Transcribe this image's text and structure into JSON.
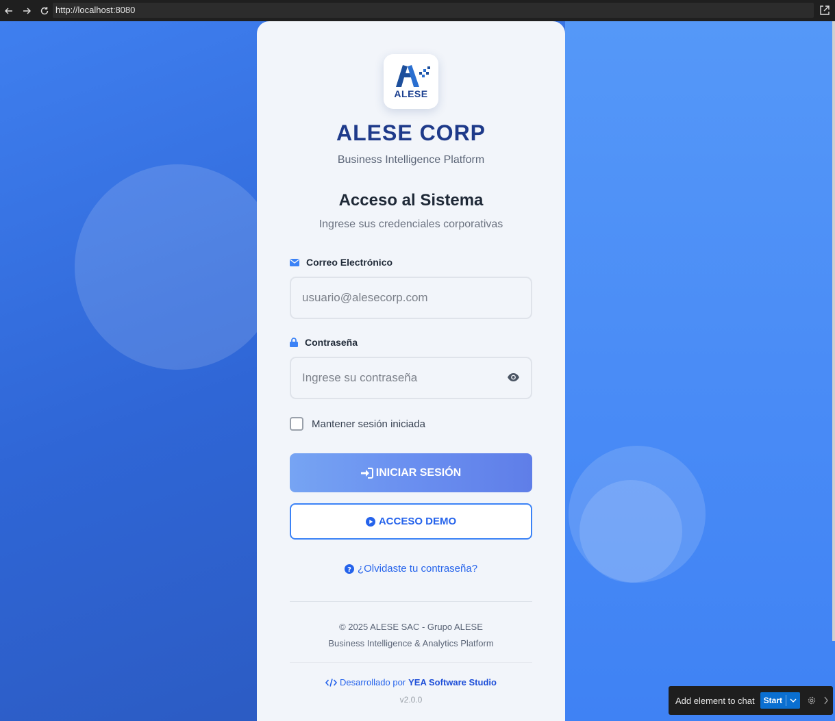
{
  "browser": {
    "url": "http://localhost:8080"
  },
  "logo": {
    "text": "ALESE"
  },
  "brand": {
    "name": "ALESE CORP",
    "tagline": "Business Intelligence Platform"
  },
  "login": {
    "heading": "Acceso al Sistema",
    "subheading": "Ingrese sus credenciales corporativas",
    "email": {
      "label": "Correo Electrónico",
      "placeholder": "usuario@alesecorp.com",
      "icon": "envelope-icon"
    },
    "password": {
      "label": "Contraseña",
      "placeholder": "Ingrese su contraseña",
      "icon": "lock-icon"
    },
    "remember_label": "Mantener sesión iniciada",
    "remember_checked": false,
    "login_button": "INICIAR SESIÓN",
    "demo_button": "ACCESO DEMO",
    "forgot_link": "¿Olvidaste tu contraseña?"
  },
  "footer": {
    "copyright": "© 2025 ALESE SAC - Grupo ALESE",
    "platform": "Business Intelligence & Analytics Platform",
    "developed_by": "Desarrollado por",
    "studio": "YEA Software Studio",
    "version": "v2.0.0"
  },
  "chat_toolbar": {
    "label": "Add element to chat",
    "start": "Start"
  },
  "colors": {
    "brand_blue": "#1e3a8a",
    "accent": "#3b82f6",
    "link": "#2563eb"
  }
}
